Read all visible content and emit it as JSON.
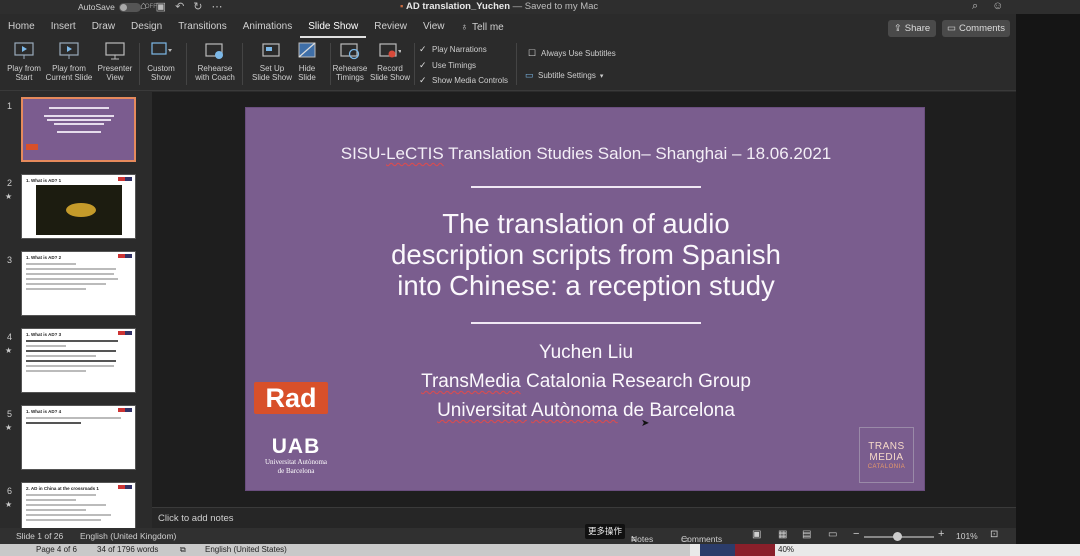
{
  "titlebar": {
    "autosave_label": "AutoSave",
    "toggle_state": "OFF",
    "document_name": "AD translation_Yuchen",
    "save_status": "— Saved to my Mac"
  },
  "tabs": [
    "Home",
    "Insert",
    "Draw",
    "Design",
    "Transitions",
    "Animations",
    "Slide Show",
    "Review",
    "View"
  ],
  "active_tab": "Slide Show",
  "tell_me": "Tell me",
  "share_label": "Share",
  "comments_label": "Comments",
  "ribbon": {
    "play_from_start": [
      "Play from",
      "Start"
    ],
    "play_from_current": [
      "Play from",
      "Current Slide"
    ],
    "presenter_view": [
      "Presenter",
      "View"
    ],
    "custom_show": [
      "Custom",
      "Show"
    ],
    "rehearse_coach": [
      "Rehearse",
      "with Coach"
    ],
    "set_up": [
      "Set Up",
      "Slide Show"
    ],
    "hide_slide": [
      "Hide",
      "Slide"
    ],
    "rehearse_timings": [
      "Rehearse",
      "Timings"
    ],
    "record_show": [
      "Record",
      "Slide Show"
    ],
    "play_narrations": "Play Narrations",
    "use_timings": "Use Timings",
    "show_media_controls": "Show Media Controls",
    "always_use_subtitles": "Always Use Subtitles",
    "subtitle_settings": "Subtitle Settings"
  },
  "thumbnails": [
    {
      "num": "1",
      "title": "The translation of audio description scripts from Spanish into Chinese: a reception study",
      "selected": true
    },
    {
      "num": "2",
      "title": "1. What is AD? 1",
      "selected": false
    },
    {
      "num": "3",
      "title": "1. What is AD? 2",
      "selected": false
    },
    {
      "num": "4",
      "title": "1. What is AD? 3",
      "selected": false
    },
    {
      "num": "5",
      "title": "1. What is AD? 4",
      "selected": false
    },
    {
      "num": "6",
      "title": "2. AD in China at the crossroads 1",
      "selected": false
    }
  ],
  "slide": {
    "subtitle_part1": "SISU-",
    "subtitle_part2": "LeCTIS",
    "subtitle_part3": " Translation Studies Salon– Shanghai – 18.06.2021",
    "title_lines": [
      "The translation of audio",
      "description scripts from Spanish",
      "into Chinese: a reception study"
    ],
    "author": "Yuchen Liu",
    "group_part1": "TransMedia",
    "group_part2": " Catalonia Research Group",
    "univ_part1": "Universitat",
    "univ_part2": " ",
    "univ_part3": "Autònoma",
    "univ_part4": " de Barcelona",
    "logo_rad": "Rad",
    "logo_uab": "UAB",
    "logo_uab_sub1": "Universitat Autònoma",
    "logo_uab_sub2": "de Barcelona",
    "logo_tm": [
      "TRANS",
      "MEDIA",
      "CATALONIA"
    ],
    "background_color": "#7a5d8e"
  },
  "notes_placeholder": "Click to add notes",
  "status": {
    "slide_count": "Slide 1 of 26",
    "language": "English (United Kingdom)",
    "tooltip": "更多操作",
    "notes": "Notes",
    "comments": "Comments",
    "zoom": "101%"
  },
  "bottom_bar": {
    "page": "Page 4 of 6",
    "words": "34 of 1796 words",
    "language": "English (United States)",
    "percent": "40%"
  }
}
